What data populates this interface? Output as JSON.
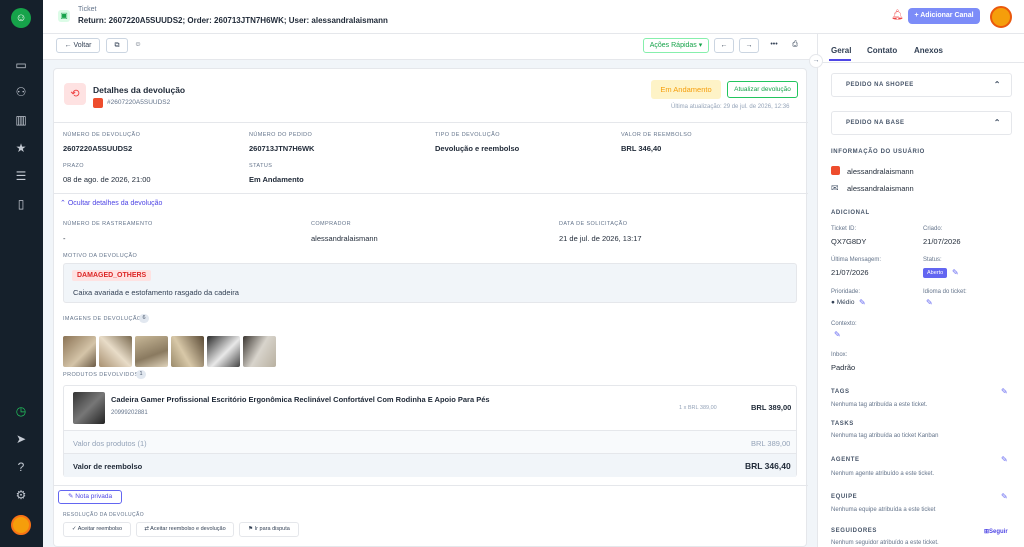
{
  "header": {
    "label": "Ticket",
    "title": "Return: 2607220A5SUUDS2; Order: 260713JTN7H6WK; User: alessandralaismann",
    "add_channel": "+ Adicionar Canal"
  },
  "toolbar": {
    "back": "Voltar",
    "quick_actions": "Ações Rápidas"
  },
  "return": {
    "title": "Detalhes da devolução",
    "subtitle": "#2607220A5SUUDS2",
    "status_badge": "Em Andamento",
    "update_button": "Atualizar devolução",
    "last_update": "Última atualização: 29 de jul. de 2026, 12:36",
    "fields": [
      {
        "label": "Número de devolução",
        "value": "2607220A5SUUDS2"
      },
      {
        "label": "Número do pedido",
        "value": "260713JTN7H6WK"
      },
      {
        "label": "Tipo de devolução",
        "value": "Devolução e reembolso"
      },
      {
        "label": "Valor de reembolso",
        "value": "BRL 346,40"
      },
      {
        "label": "Prazo",
        "value": "08 de ago. de 2026, 21:00"
      },
      {
        "label": "Status",
        "value": "Em Andamento"
      }
    ],
    "hide_details": "Ocultar detalhes da devolução",
    "details": [
      {
        "label": "Número de rastreamento",
        "value": "-"
      },
      {
        "label": "Comprador",
        "value": "alessandralaismann"
      },
      {
        "label": "Data de solicitação",
        "value": "21 de jul. de 2026, 13:17"
      }
    ],
    "reason_label": "Motivo da devolução",
    "reason_code": "DAMAGED_OTHERS",
    "reason_text": "Caixa avariada e estofamento rasgado da cadeira",
    "images_label": "Imagens de devolução",
    "images_count": "6",
    "products_label": "Produtos devolvidos",
    "products_count": "1",
    "product": {
      "name": "Cadeira Gamer Profissional Escritório Ergonômica Reclinável Confortável Com Rodinha E Apoio Para Pés",
      "sku": "20999202881",
      "unit": "1 x BRL 389,00",
      "price": "BRL 389,00"
    },
    "products_value_label": "Valor dos produtos (1)",
    "products_value": "BRL 389,00",
    "refund_label": "Valor de reembolso",
    "refund_value": "BRL 346,40",
    "private_note": "Nota privada",
    "resolution_label": "Resolução da devolução",
    "actions": [
      "Aceitar reembolso",
      "Aceitar reembolso e devolução",
      "Ir para disputa"
    ]
  },
  "right": {
    "tabs": [
      "Geral",
      "Contato",
      "Anexos"
    ],
    "acc1": "PEDIDO NA SHOPEE",
    "acc2": "PEDIDO NA BASE",
    "user_info": "INFORMAÇÃO DO USUÁRIO",
    "user1": "alessandralaismann",
    "user2": "alessandralaismann",
    "additional": "ADICIONAL",
    "ticket_id_label": "Ticket ID:",
    "ticket_id": "QX7G8DY",
    "created_label": "Criado:",
    "created": "21/07/2026",
    "last_msg_label": "Última Mensagem:",
    "last_msg": "21/07/2026",
    "status_label": "Status:",
    "status": "Aberto",
    "priority_label": "Prioridade:",
    "priority": "Médio",
    "language_label": "Idioma do ticket:",
    "context_label": "Contexto:",
    "inbox_label": "Inbox:",
    "inbox": "Padrão",
    "tags": "TAGS",
    "tags_empty": "Nenhuma tag atribuída a este ticket.",
    "tasks": "TASKS",
    "tasks_empty": "Nenhuma tag atribuída ao ticket Kanban",
    "agent": "AGENTE",
    "agent_empty": "Nenhum agente atribuído a este ticket.",
    "team": "EQUIPE",
    "team_empty": "Nenhuma equipe atribuída a este ticket",
    "followers": "SEGUIDORES",
    "follow": "Seguir",
    "followers_empty": "Nenhum seguidor atribuído a este ticket."
  }
}
